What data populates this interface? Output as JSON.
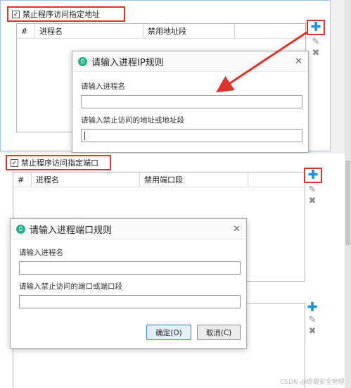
{
  "section1": {
    "checkbox_label": "禁止程序访问指定地址",
    "checked_mark": "✓",
    "columns": [
      "#",
      "进程名",
      "禁用地址段"
    ],
    "dialog": {
      "title": "请输入进程IP规则",
      "field1_label": "请输入进程名",
      "field1_value": "",
      "field2_label": "请输入禁止访问的地址或地址段",
      "field2_value": ""
    }
  },
  "section2": {
    "checkbox_label": "禁止程序访问指定端口",
    "checked_mark": "✓",
    "columns": [
      "#",
      "进程名",
      "禁用端口段"
    ],
    "dialog": {
      "title": "请输入进程端口规则",
      "field1_label": "请输入进程名",
      "field1_value": "",
      "field2_label": "请输入禁止访问的端口或端口段",
      "field2_value": "",
      "ok_label": "确定(O)",
      "cancel_label": "取消(C)"
    }
  },
  "icons": {
    "plus": "✚",
    "pencil": "✎",
    "delete": "✖",
    "close": "✕"
  },
  "colors": {
    "accent_red": "#e0332b",
    "plus_blue": "#1a8fe0",
    "logo_green": "#20b389"
  },
  "watermark": "CSDN @终端安全管理"
}
